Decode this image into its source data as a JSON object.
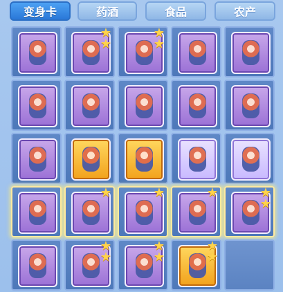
{
  "tabs": [
    {
      "label": "变身卡",
      "active": true
    },
    {
      "label": "药酒",
      "active": false
    },
    {
      "label": "食品",
      "active": false
    },
    {
      "label": "农产",
      "active": false
    }
  ],
  "grid": {
    "rows": 5,
    "cols": 5,
    "items": [
      {
        "style": "purple",
        "stars": 0,
        "glow": false,
        "empty": false
      },
      {
        "style": "purple",
        "stars": 2,
        "glow": false,
        "empty": false
      },
      {
        "style": "purple",
        "stars": 2,
        "glow": false,
        "empty": false
      },
      {
        "style": "purple",
        "stars": 0,
        "glow": false,
        "empty": false
      },
      {
        "style": "purple",
        "stars": 0,
        "glow": false,
        "empty": false
      },
      {
        "style": "purple",
        "stars": 0,
        "glow": false,
        "empty": false
      },
      {
        "style": "purple",
        "stars": 0,
        "glow": false,
        "empty": false
      },
      {
        "style": "purple",
        "stars": 0,
        "glow": false,
        "empty": false
      },
      {
        "style": "purple",
        "stars": 0,
        "glow": false,
        "empty": false
      },
      {
        "style": "purple",
        "stars": 0,
        "glow": false,
        "empty": false
      },
      {
        "style": "purple",
        "stars": 0,
        "glow": false,
        "empty": false
      },
      {
        "style": "gold",
        "stars": 0,
        "glow": false,
        "empty": false
      },
      {
        "style": "gold",
        "stars": 0,
        "glow": false,
        "empty": false
      },
      {
        "style": "light",
        "stars": 0,
        "glow": false,
        "empty": false
      },
      {
        "style": "light",
        "stars": 0,
        "glow": false,
        "empty": false
      },
      {
        "style": "purple",
        "stars": 0,
        "glow": true,
        "empty": false
      },
      {
        "style": "purple",
        "stars": 1,
        "glow": true,
        "empty": false
      },
      {
        "style": "purple",
        "stars": 1,
        "glow": true,
        "empty": false
      },
      {
        "style": "purple",
        "stars": 1,
        "glow": true,
        "empty": false
      },
      {
        "style": "purple",
        "stars": 2,
        "glow": true,
        "empty": false
      },
      {
        "style": "purple",
        "stars": 0,
        "glow": false,
        "empty": false
      },
      {
        "style": "purple",
        "stars": 2,
        "glow": false,
        "empty": false
      },
      {
        "style": "purple",
        "stars": 2,
        "glow": false,
        "empty": false
      },
      {
        "style": "gold",
        "stars": 2,
        "glow": false,
        "empty": false
      },
      {
        "style": "empty",
        "stars": 0,
        "glow": false,
        "empty": true
      }
    ]
  }
}
